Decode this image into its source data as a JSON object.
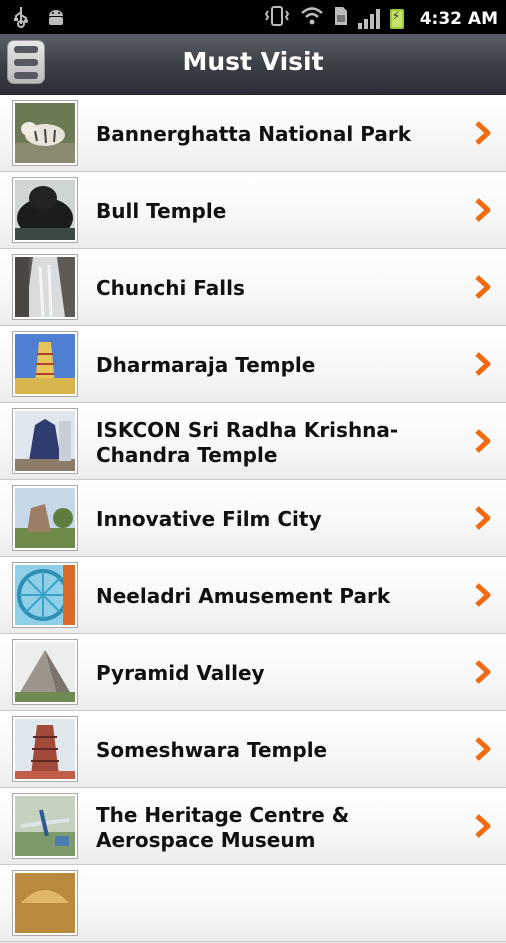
{
  "status_bar": {
    "time": "4:32 AM",
    "icons": [
      "usb-icon",
      "android-debug-icon",
      "vibrate-icon",
      "wifi-icon",
      "sim-icon",
      "signal-icon",
      "battery-charging-icon"
    ]
  },
  "header": {
    "title": "Must Visit",
    "menu_icon": "hamburger-menu-icon"
  },
  "list": {
    "items": [
      {
        "label": "Bannerghatta National Park",
        "thumb": "white-tiger"
      },
      {
        "label": "Bull Temple",
        "thumb": "bull-statue"
      },
      {
        "label": "Chunchi Falls",
        "thumb": "waterfall"
      },
      {
        "label": "Dharmaraja Temple",
        "thumb": "temple-tower"
      },
      {
        "label": "ISKCON Sri Radha Krishna-Chandra Temple",
        "thumb": "iskcon-temple"
      },
      {
        "label": "Innovative Film City",
        "thumb": "film-city"
      },
      {
        "label": "Neeladri Amusement Park",
        "thumb": "ferris-wheel"
      },
      {
        "label": "Pyramid Valley",
        "thumb": "pyramid"
      },
      {
        "label": "Someshwara Temple",
        "thumb": "gopuram"
      },
      {
        "label": "The Heritage Centre & Aerospace Museum",
        "thumb": "aircraft"
      },
      {
        "label": "",
        "thumb": "palace"
      }
    ],
    "chevron_icon": "chevron-right-icon",
    "accent_color": "#f06a0f"
  }
}
